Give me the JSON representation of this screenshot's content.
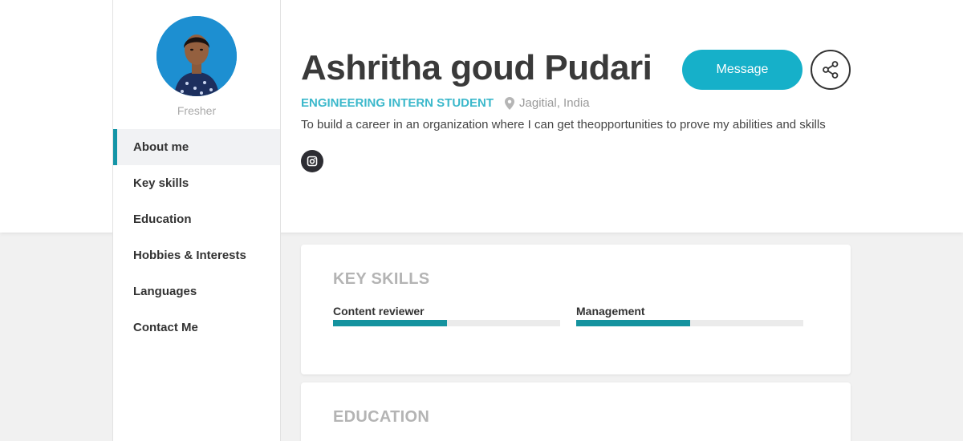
{
  "profile": {
    "name": "Ashritha goud Pudari",
    "role_tag": "Fresher",
    "designation": "ENGINEERING INTERN STUDENT",
    "location": "Jagitial, India",
    "summary": "To build a career in an organization where I can get theopportunities to prove my abilities and skills"
  },
  "actions": {
    "message_label": "Message",
    "share_icon": "share-icon"
  },
  "social": {
    "instagram_icon": "instagram-icon"
  },
  "nav": {
    "items": [
      {
        "label": "About me",
        "active": true
      },
      {
        "label": "Key skills",
        "active": false
      },
      {
        "label": "Education",
        "active": false
      },
      {
        "label": "Hobbies & Interests",
        "active": false
      },
      {
        "label": "Languages",
        "active": false
      },
      {
        "label": "Contact Me",
        "active": false
      }
    ]
  },
  "key_skills": {
    "title": "KEY SKILLS",
    "skills": [
      {
        "name": "Content reviewer",
        "level": 0.5
      },
      {
        "name": "Management",
        "level": 0.5
      }
    ]
  },
  "education": {
    "title": "EDUCATION"
  },
  "colors": {
    "accent": "#16b0c9",
    "skill_bar": "#15939f",
    "designation": "#3bb8cb",
    "active_nav_border": "#1495a7"
  }
}
